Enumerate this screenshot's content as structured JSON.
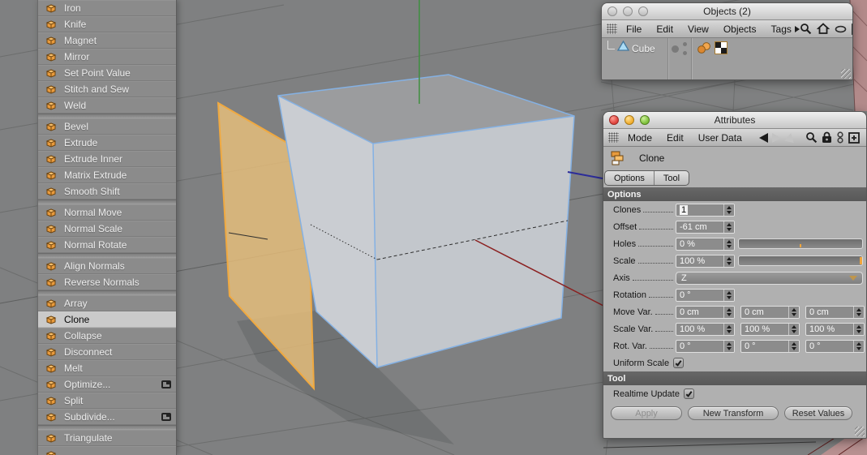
{
  "tool_menu": {
    "items": [
      {
        "label": "Iron",
        "icon": "iron-icon"
      },
      {
        "label": "Knife",
        "icon": "knife-icon"
      },
      {
        "label": "Magnet",
        "icon": "magnet-icon"
      },
      {
        "label": "Mirror",
        "icon": "mirror-icon"
      },
      {
        "label": "Set Point Value",
        "icon": "set-point-value-icon"
      },
      {
        "label": "Stitch and Sew",
        "icon": "stitch-and-sew-icon"
      },
      {
        "label": "Weld",
        "icon": "weld-icon",
        "group_end": true
      },
      {
        "label": "Bevel",
        "icon": "bevel-icon"
      },
      {
        "label": "Extrude",
        "icon": "extrude-icon"
      },
      {
        "label": "Extrude Inner",
        "icon": "extrude-inner-icon"
      },
      {
        "label": "Matrix Extrude",
        "icon": "matrix-extrude-icon"
      },
      {
        "label": "Smooth Shift",
        "icon": "smooth-shift-icon",
        "group_end": true
      },
      {
        "label": "Normal Move",
        "icon": "normal-move-icon"
      },
      {
        "label": "Normal Scale",
        "icon": "normal-scale-icon"
      },
      {
        "label": "Normal Rotate",
        "icon": "normal-rotate-icon",
        "group_end": true
      },
      {
        "label": "Align Normals",
        "icon": "align-normals-icon"
      },
      {
        "label": "Reverse Normals",
        "icon": "reverse-normals-icon",
        "group_end": true
      },
      {
        "label": "Array",
        "icon": "array-icon"
      },
      {
        "label": "Clone",
        "icon": "clone-icon",
        "selected": true
      },
      {
        "label": "Collapse",
        "icon": "collapse-icon"
      },
      {
        "label": "Disconnect",
        "icon": "disconnect-icon"
      },
      {
        "label": "Melt",
        "icon": "melt-icon"
      },
      {
        "label": "Optimize...",
        "icon": "optimize-icon",
        "opens_dialog": true
      },
      {
        "label": "Split",
        "icon": "split-icon"
      },
      {
        "label": "Subdivide...",
        "icon": "subdivide-icon",
        "opens_dialog": true,
        "group_end": true
      },
      {
        "label": "Triangulate",
        "icon": "triangulate-icon"
      },
      {
        "label": "",
        "icon": "clipped-item-icon"
      }
    ]
  },
  "objects_panel": {
    "title": "Objects (2)",
    "menu": {
      "file": "File",
      "edit": "Edit",
      "view": "View",
      "objects": "Objects",
      "tags": "Tags"
    },
    "object_row": {
      "name": "Cube"
    }
  },
  "attributes_panel": {
    "title": "Attributes",
    "menu": {
      "mode": "Mode",
      "edit": "Edit",
      "user_data": "User Data"
    },
    "object_name": "Clone",
    "tabs": {
      "options": "Options",
      "tool": "Tool"
    },
    "options": {
      "header": "Options",
      "clones": {
        "label": "Clones",
        "value": "1"
      },
      "offset": {
        "label": "Offset",
        "value": "-61 cm"
      },
      "holes": {
        "label": "Holes",
        "value": "0 %"
      },
      "scale": {
        "label": "Scale",
        "value": "100 %"
      },
      "axis": {
        "label": "Axis",
        "value": "Z"
      },
      "rotation": {
        "label": "Rotation",
        "value": "0 °"
      },
      "move_var": {
        "label": "Move Var.",
        "values": [
          "0 cm",
          "0 cm",
          "0 cm"
        ]
      },
      "scale_var": {
        "label": "Scale Var.",
        "values": [
          "100 %",
          "100 %",
          "100 %"
        ]
      },
      "rot_var": {
        "label": "Rot. Var.",
        "values": [
          "0 °",
          "0 °",
          "0 °"
        ]
      },
      "uniform_scale": {
        "label": "Uniform Scale",
        "checked": true
      }
    },
    "tool": {
      "header": "Tool",
      "realtime_update": {
        "label": "Realtime Update",
        "checked": true
      },
      "buttons": {
        "apply": {
          "label": "Apply",
          "enabled": false
        },
        "new_transform": {
          "label": "New Transform",
          "enabled": true
        },
        "reset_values": {
          "label": "Reset Values",
          "enabled": true
        }
      }
    }
  },
  "viewport": {
    "selected_object": "Cube",
    "colors": {
      "background": "#7f8081",
      "selection_wireframe": "#84b1e4",
      "clone_preview_outline": "#f0a940",
      "axis_x_red": "#8b2020",
      "axis_y_green": "#3f8f3f",
      "axis_z_blue": "#2c2c99",
      "accent_orange": "#f0a53c"
    }
  }
}
